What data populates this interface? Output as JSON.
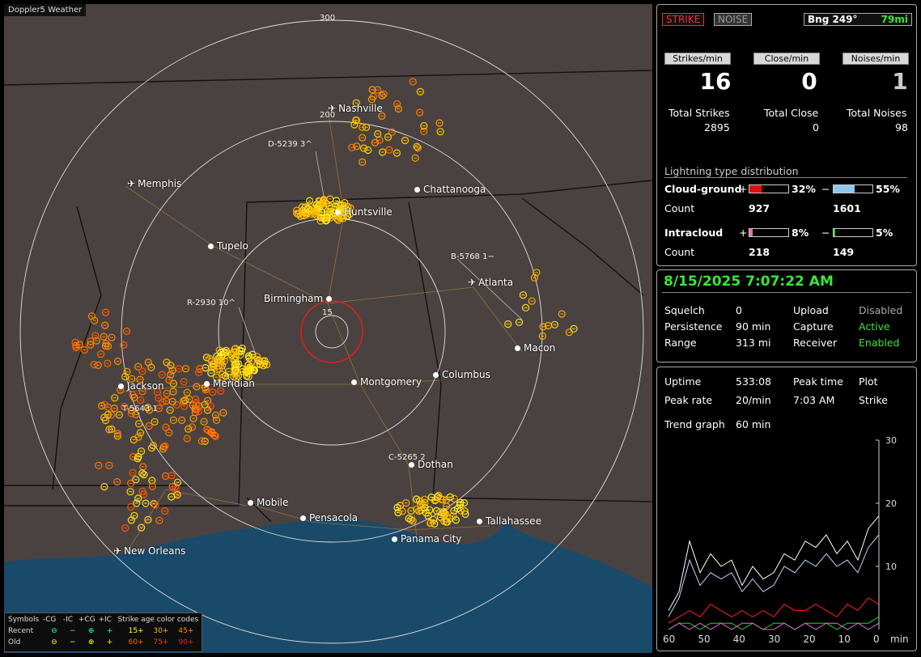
{
  "app_title": "Doppler5 Weather",
  "cities": [
    {
      "name": "Nashville",
      "airport": true
    },
    {
      "name": "Memphis",
      "airport": true
    },
    {
      "name": "Chattanooga",
      "airport": false
    },
    {
      "name": "Huntsville",
      "airport": false
    },
    {
      "name": "Tupelo",
      "airport": false
    },
    {
      "name": "Birmingham",
      "airport": false
    },
    {
      "name": "Atlanta",
      "airport": true
    },
    {
      "name": "Macon",
      "airport": false
    },
    {
      "name": "Jackson",
      "airport": false
    },
    {
      "name": "Meridian",
      "airport": false
    },
    {
      "name": "Montgomery",
      "airport": false
    },
    {
      "name": "Columbus",
      "airport": false
    },
    {
      "name": "Dothan",
      "airport": false
    },
    {
      "name": "Mobile",
      "airport": false
    },
    {
      "name": "Pensacola",
      "airport": false
    },
    {
      "name": "Tallahassee",
      "airport": false
    },
    {
      "name": "Panama City",
      "airport": false
    },
    {
      "name": "New Orleans",
      "airport": true
    }
  ],
  "sensors": [
    "D-5239 3^",
    "B-5768 1−",
    "R-2930 10^",
    "T-5643 1",
    "C-5265 2"
  ],
  "rings": {
    "r300": "300",
    "r200": "200",
    "r15": "15"
  },
  "legend": {
    "header": "Symbols",
    "cols": [
      "-CG",
      "-IC",
      "+CG",
      "+IC"
    ],
    "age_title": "Strike age color codes",
    "recent": "Recent",
    "old": "Old",
    "recent_sym": [
      "⊖",
      "−",
      "⊕",
      "+"
    ],
    "old_sym": [
      "⊖",
      "−",
      "⊕",
      "+"
    ],
    "recent_ages": [
      "15+",
      "30+",
      "45+"
    ],
    "old_ages": [
      "60+",
      "75+",
      "90+"
    ],
    "recent_colors": [
      "#ffff33",
      "#ffbb22",
      "#ff8800"
    ],
    "old_colors": [
      "#ff6600",
      "#ff4400",
      "#ee2200"
    ]
  },
  "top": {
    "strike_btn": "STRIKE",
    "noise_btn": "NOISE",
    "bearing": "Bng 249°",
    "distance": "79mi",
    "labels": [
      "Strikes/min",
      "Close/min",
      "Noises/min"
    ],
    "values": [
      "16",
      "0",
      "1"
    ],
    "totals_labels": [
      "Total Strikes",
      "Total Close",
      "Total Noises"
    ],
    "totals": [
      "2895",
      "0",
      "98"
    ],
    "dist_title": "Lightning type distribution",
    "cg": "Cloud-ground",
    "ic": "Intracloud",
    "count": "Count",
    "plus": "+",
    "minus": "−",
    "cg_pos_pct": "32%",
    "cg_neg_pct": "55%",
    "cg_pos_count": "927",
    "cg_neg_count": "1601",
    "ic_pos_pct": "8%",
    "ic_neg_pct": "5%",
    "ic_pos_count": "218",
    "ic_neg_count": "149",
    "cg_pos_frac": 0.32,
    "cg_neg_frac": 0.55,
    "ic_pos_frac": 0.08,
    "ic_neg_frac": 0.05
  },
  "status": {
    "datetime": "8/15/2025 7:07:22 AM",
    "squelch_l": "Squelch",
    "squelch": "0",
    "persist_l": "Persistence",
    "persist": "90 min",
    "range_l": "Range",
    "range": "313 mi",
    "upload_l": "Upload",
    "upload": "Disabled",
    "capture_l": "Capture",
    "capture": "Active",
    "receiver_l": "Receiver",
    "receiver": "Enabled"
  },
  "trend": {
    "uptime_l": "Uptime",
    "uptime": "533:08",
    "peak_time_l": "Peak time",
    "peak_time": "7:03 AM",
    "plot_l": "Plot",
    "plot": "Strike",
    "peak_rate_l": "Peak rate",
    "peak_rate": "20/min",
    "trend_l": "Trend graph",
    "trend": "60 min",
    "y_ticks": [
      "30",
      "20",
      "10"
    ],
    "x_ticks": [
      "60",
      "50",
      "40",
      "30",
      "20",
      "10",
      "0"
    ],
    "x_unit": "min"
  },
  "chart_data": {
    "type": "line",
    "x": [
      60,
      57,
      54,
      51,
      48,
      45,
      42,
      39,
      36,
      33,
      30,
      27,
      24,
      21,
      18,
      15,
      12,
      9,
      6,
      3,
      0
    ],
    "xlabel": "min",
    "ylim": [
      0,
      30
    ],
    "series": [
      {
        "values": [
          3,
          6,
          14,
          9,
          12,
          10,
          11,
          7,
          10,
          8,
          9,
          12,
          11,
          14,
          13,
          15,
          12,
          14,
          11,
          16,
          18
        ]
      },
      {
        "values": [
          2,
          5,
          11,
          7,
          9,
          8,
          9,
          6,
          8,
          6,
          7,
          10,
          9,
          11,
          10,
          12,
          10,
          11,
          9,
          13,
          15
        ]
      },
      {
        "values": [
          1,
          2,
          3,
          2,
          4,
          3,
          2,
          3,
          2,
          3,
          2,
          4,
          3,
          3,
          4,
          3,
          2,
          4,
          3,
          5,
          4
        ]
      },
      {
        "values": [
          0,
          1,
          1,
          0,
          1,
          1,
          1,
          0,
          1,
          0,
          1,
          1,
          0,
          1,
          1,
          1,
          0,
          1,
          1,
          1,
          2
        ]
      },
      {
        "values": [
          0,
          1,
          0,
          1,
          0,
          1,
          0,
          1,
          1,
          0,
          0,
          1,
          0,
          1,
          0,
          1,
          1,
          0,
          1,
          0,
          1
        ]
      }
    ]
  }
}
